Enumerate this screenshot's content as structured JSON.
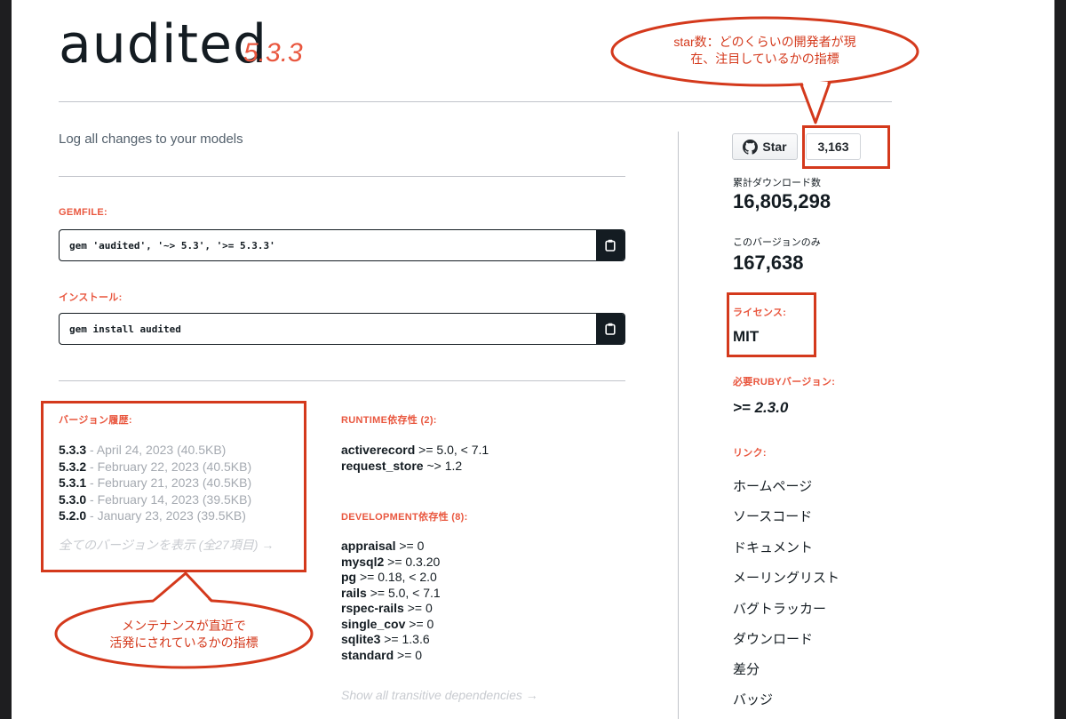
{
  "gem": {
    "name": "audited",
    "version": "5.3.3",
    "description": "Log all changes to your models"
  },
  "gemfile": {
    "label": "GEMFILE:",
    "code": "gem 'audited', '~> 5.3', '>= 5.3.3'"
  },
  "install": {
    "label": "インストール:",
    "code": "gem install audited"
  },
  "versions": {
    "label": "バージョン履歴:",
    "items": [
      {
        "number": "5.3.3",
        "detail": " - April 24, 2023 (40.5KB)"
      },
      {
        "number": "5.3.2",
        "detail": " - February 22, 2023 (40.5KB)"
      },
      {
        "number": "5.3.1",
        "detail": " - February 21, 2023 (40.5KB)"
      },
      {
        "number": "5.3.0",
        "detail": " - February 14, 2023 (39.5KB)"
      },
      {
        "number": "5.2.0",
        "detail": " - January 23, 2023 (39.5KB)"
      }
    ],
    "show_all": "全てのバージョンを表示 (全27項目) →"
  },
  "runtime": {
    "label": "RUNTIME依存性 (2):",
    "items": [
      {
        "name": "activerecord",
        "req": " >= 5.0, < 7.1"
      },
      {
        "name": "request_store",
        "req": " ~> 1.2"
      }
    ]
  },
  "development": {
    "label": "DEVELOPMENT依存性 (8):",
    "items": [
      {
        "name": "appraisal",
        "req": " >= 0"
      },
      {
        "name": "mysql2",
        "req": " >= 0.3.20"
      },
      {
        "name": "pg",
        "req": " >= 0.18, < 2.0"
      },
      {
        "name": "rails",
        "req": " >= 5.0, < 7.1"
      },
      {
        "name": "rspec-rails",
        "req": " >= 0"
      },
      {
        "name": "single_cov",
        "req": " >= 0"
      },
      {
        "name": "sqlite3",
        "req": " >= 1.3.6"
      },
      {
        "name": "standard",
        "req": " >= 0"
      }
    ],
    "show_transitive": "Show all transitive dependencies →"
  },
  "sidebar": {
    "star_label": "Star",
    "star_count": "3,163",
    "total_downloads_label": "累計ダウンロード数",
    "total_downloads": "16,805,298",
    "version_downloads_label": "このバージョンのみ",
    "version_downloads": "167,638",
    "license_label": "ライセンス:",
    "license": "MIT",
    "ruby_label": "必要RUBYバージョン:",
    "ruby_version": ">= 2.3.0",
    "links_label": "リンク:",
    "links": [
      "ホームページ",
      "ソースコード",
      "ドキュメント",
      "メーリングリスト",
      "バグトラッカー",
      "ダウンロード",
      "差分",
      "バッジ"
    ]
  },
  "annotations": {
    "star_callout_line1": "star数：どのくらいの開発者が現",
    "star_callout_line2": "在、注目しているかの指標",
    "version_callout_line1": "メンテナンスが直近で",
    "version_callout_line2": "活発にされているかの指標"
  },
  "colors": {
    "accent": "#e9573f",
    "annotation": "#d4391c",
    "text": "#141c22"
  }
}
